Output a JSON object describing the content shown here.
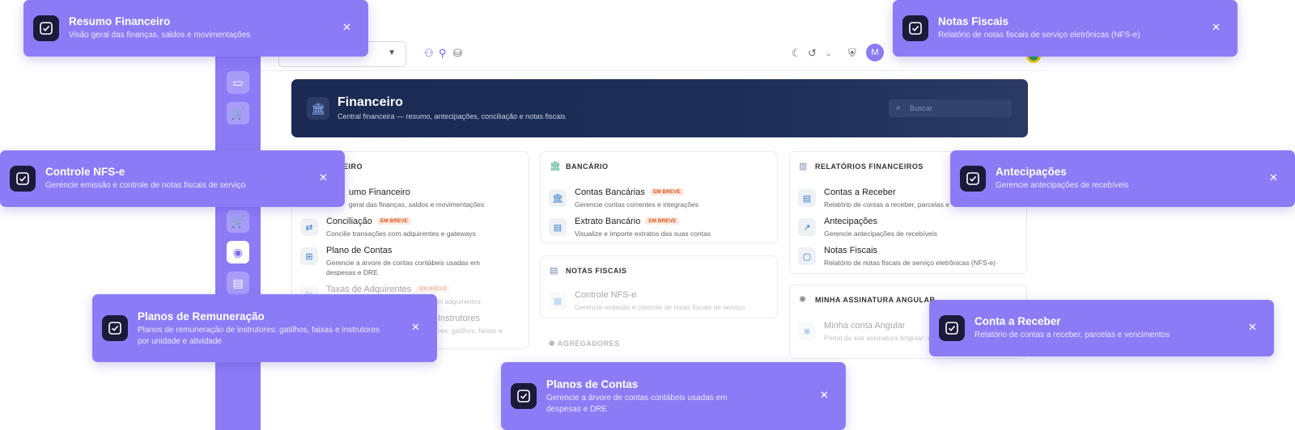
{
  "app": {
    "avatar_initial": "M",
    "hero": {
      "title": "Financeiro",
      "subtitle": "Central financeira — resumo, antecipações, conciliação e notas fiscais",
      "search_placeholder": "Buscar"
    },
    "cards": {
      "financeiro": {
        "header": "CEIRO",
        "items": [
          {
            "title": "umo Financeiro",
            "desc": "geral das finanças, saldos e movimentações"
          },
          {
            "title": "Conciliação",
            "badge": "EM BREVE",
            "desc": "Concilie transações com adquirentes e gateways"
          },
          {
            "title": "Plano de Contas",
            "desc": "Gerencie a árvore de contas contábeis usadas em despesas e DRE"
          },
          {
            "title": "Taxas de Adquirentes",
            "badge": "EM BREVE",
            "desc": "com adquirentes"
          },
          {
            "title": "Instrutores",
            "desc": "res, gatilhos, faixas e"
          }
        ]
      },
      "bancario": {
        "header": "BANCÁRIO",
        "items": [
          {
            "title": "Contas Bancárias",
            "badge": "EM BREVE",
            "desc": "Gerencie contas correntes e integrações"
          },
          {
            "title": "Extrato Bancário",
            "badge": "EM BREVE",
            "desc": "Visualize e importe extratos das suas contas"
          }
        ]
      },
      "notas": {
        "header": "NOTAS FISCAIS",
        "items": [
          {
            "title": "Controle NFS-e",
            "desc": "Gerencie emissão e controle de notas fiscais de serviço"
          }
        ]
      },
      "agregadores": {
        "header": "AGREGADORES"
      },
      "relatorios": {
        "header": "RELATÓRIOS FINANCEIROS",
        "items": [
          {
            "title": "Contas a Receber",
            "desc": "Relatório de contas a receber, parcelas e"
          },
          {
            "title": "Antecipações",
            "desc": "Gerencie antecipações de recebíveis"
          },
          {
            "title": "Notas Fiscais",
            "desc": "Relatório de notas fiscais de serviço eletrônicas (NFS-e)"
          }
        ]
      },
      "assinatura": {
        "header": "MINHA ASSINATURA ANGULAR",
        "items": [
          {
            "title": "Minha conta Angular",
            "desc": "Portal da sua assinatura Angular: serviços, contrato, pagamento e"
          }
        ]
      }
    }
  },
  "toasts": [
    {
      "title": "Resumo Financeiro",
      "desc": "Visão geral das finanças, saldos e movimentações"
    },
    {
      "title": "Notas Fiscais",
      "desc": "Relatório de notas fiscais de serviço eletrônicas (NFS-e)"
    },
    {
      "title": "Controle NFS-e",
      "desc": "Gerencie emissão e controle de notas fiscais de serviço"
    },
    {
      "title": "Antecipações",
      "desc": "Gerencie antecipações de recebíveis"
    },
    {
      "title": "Planos de Remuneração",
      "desc": "Planos de remuneração de instrutores: gatilhos, faixas e instrutores por unidade e atividade"
    },
    {
      "title": "Conta a Receber",
      "desc": "Relatório de contas a receber, parcelas e vencimentos"
    },
    {
      "title": "Planos de Contas",
      "desc": "Gerencie a árvore de contas contábeis usadas em despesas e DRE"
    }
  ],
  "colors": {
    "toast": "#8b7cf6",
    "hero": "#1a2a52",
    "badge": "#d9541e"
  }
}
